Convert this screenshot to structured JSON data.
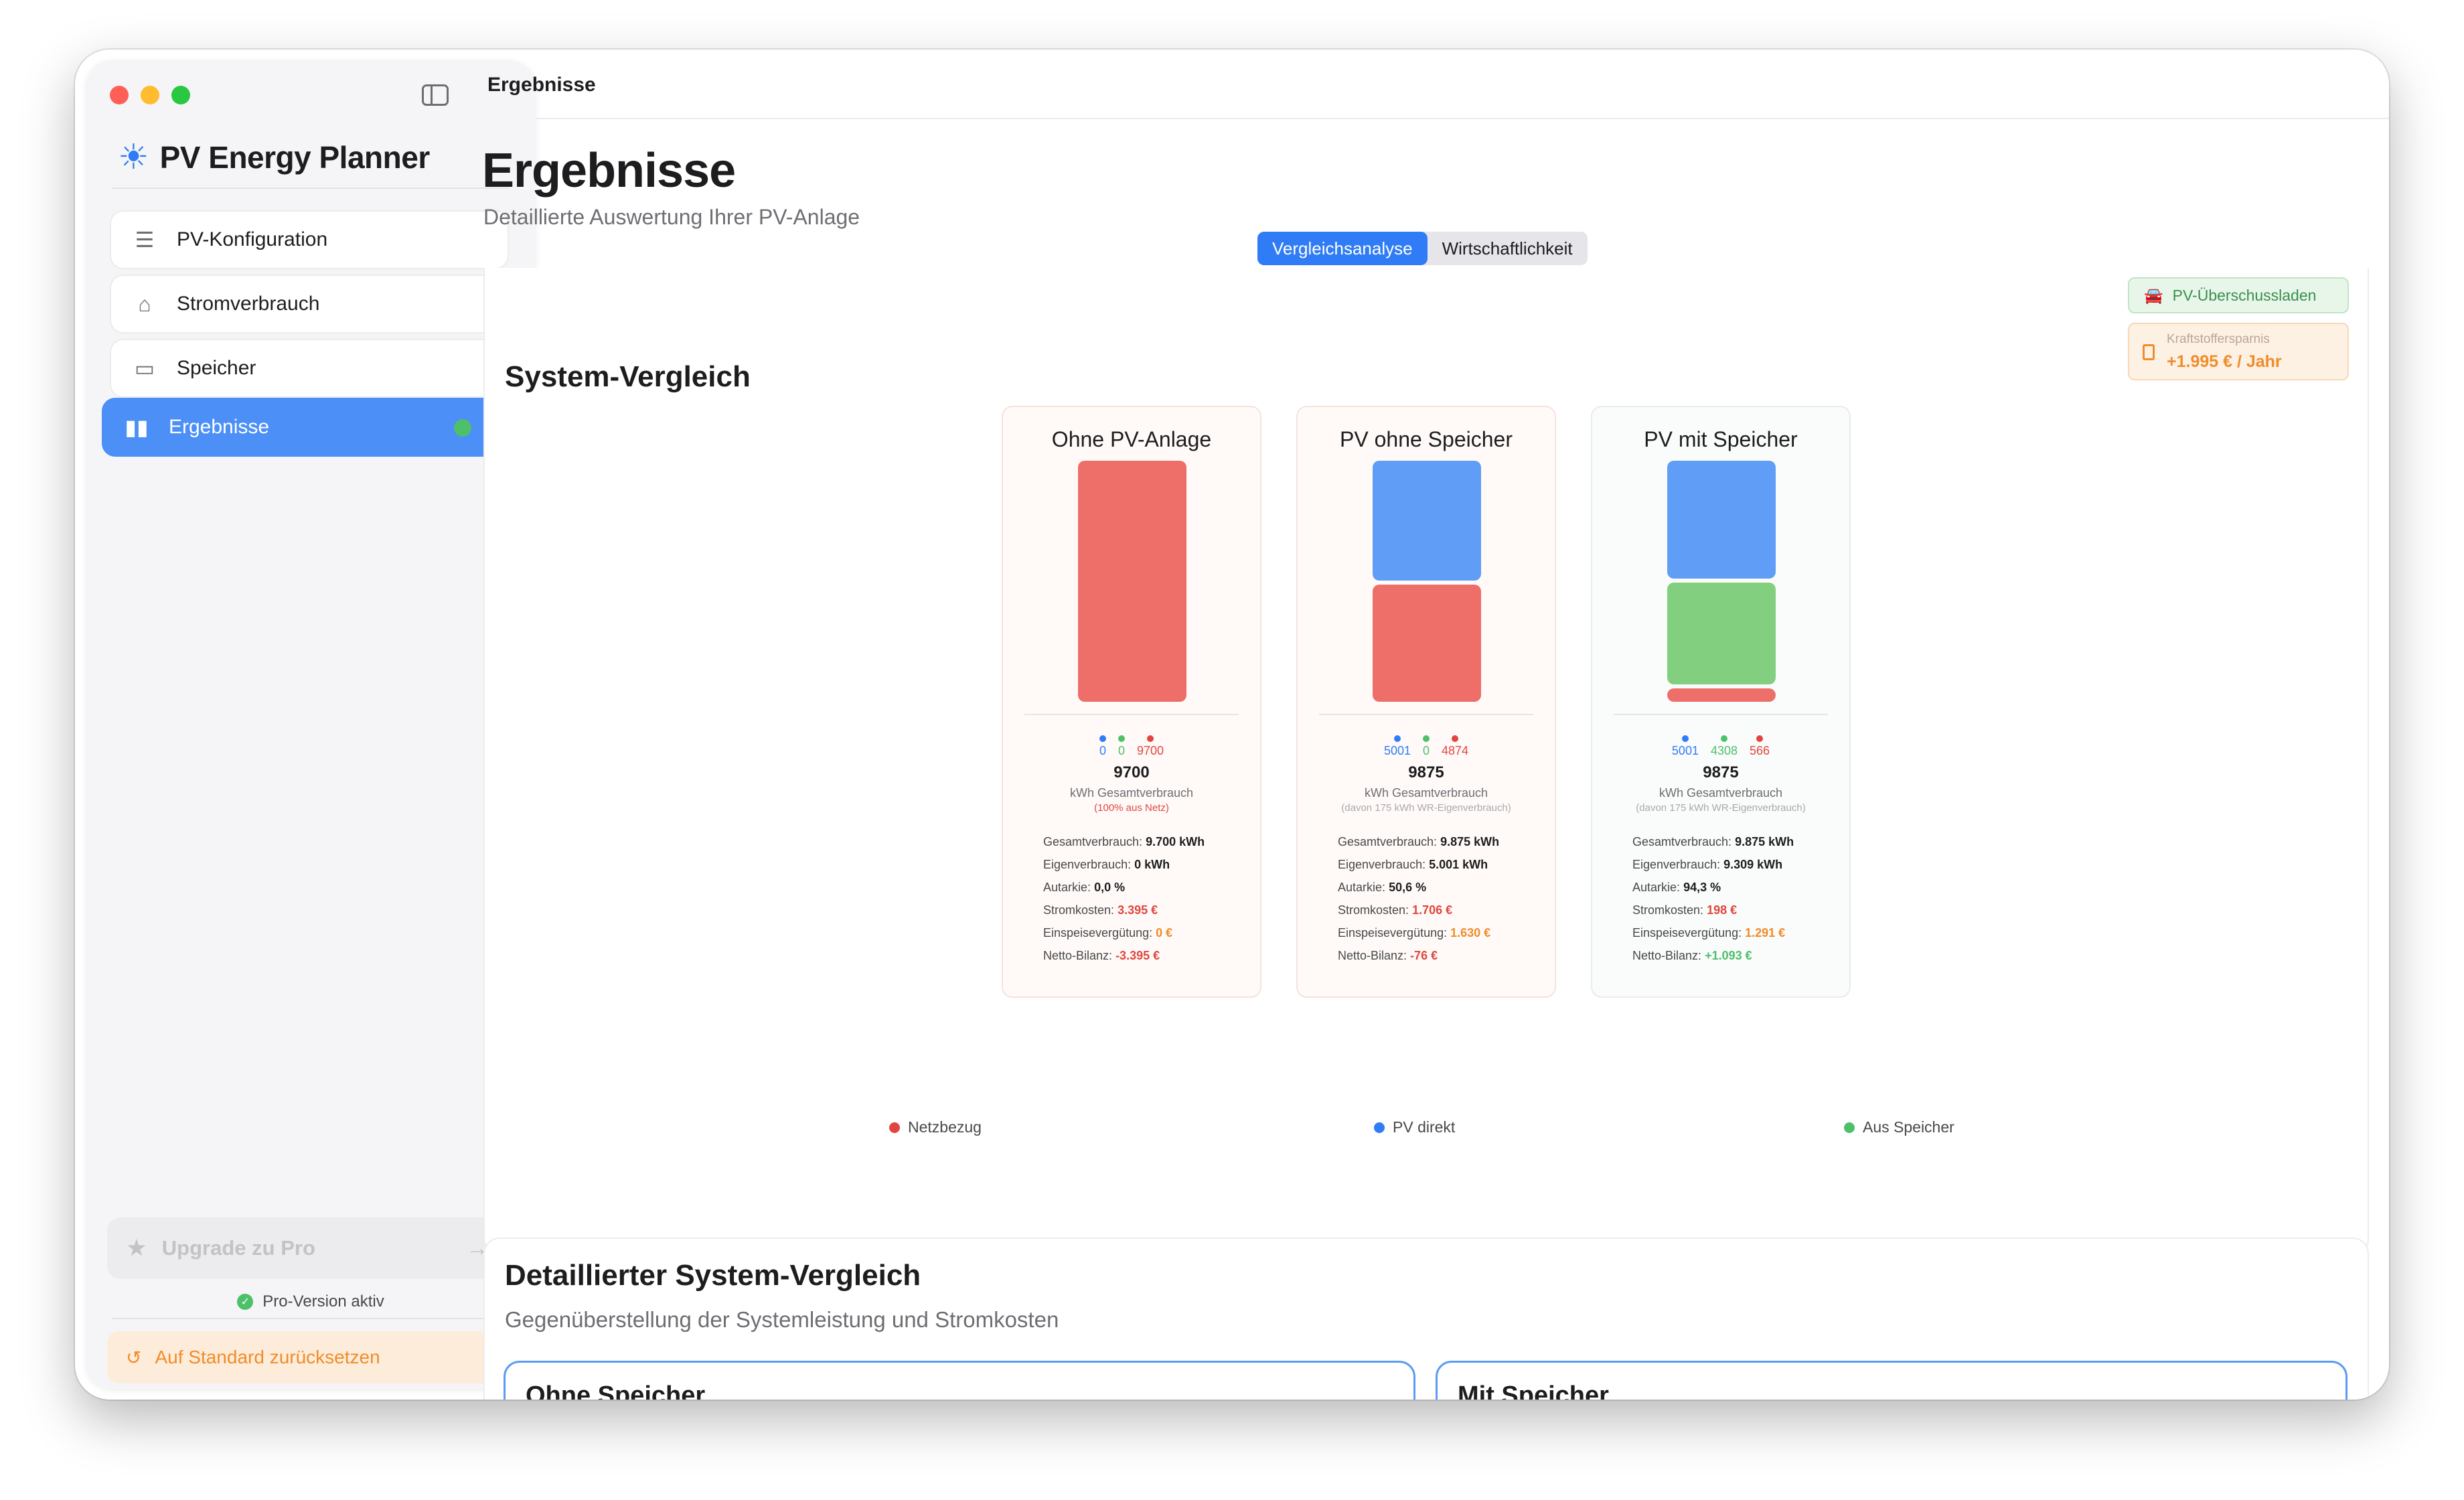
{
  "window": {
    "title": "Ergebnisse"
  },
  "colors": {
    "red": "#ee6e69",
    "blue": "#5f9df6",
    "green": "#83cf80",
    "accent": "#2f7cf6"
  },
  "sidebar": {
    "brand": "PV Energy Planner",
    "items": [
      {
        "label": "PV-Konfiguration",
        "icon": "sliders-icon"
      },
      {
        "label": "Stromverbrauch",
        "icon": "house-icon"
      },
      {
        "label": "Speicher",
        "icon": "battery-icon"
      },
      {
        "label": "Ergebnisse",
        "icon": "chart-bars-icon",
        "active": true
      }
    ],
    "upgrade_label": "Upgrade zu Pro",
    "pro_status": "Pro-Version aktiv",
    "reset_label": "Auf Standard zurücksetzen"
  },
  "main": {
    "title": "Ergebnisse",
    "subtitle": "Detaillierte Auswertung Ihrer PV-Anlage",
    "tabs": [
      {
        "label": "Vergleichsanalyse",
        "active": true
      },
      {
        "label": "Wirtschaftlichkeit",
        "active": false
      }
    ],
    "system_compare": {
      "title": "System-Vergleich",
      "badge_surplus": "PV-Überschussladen",
      "badge_fuel_label": "Kraftstoffersparnis",
      "badge_fuel_value": "+1.995 € / Jahr",
      "columns": [
        {
          "title": "Ohne PV-Anlage",
          "pv_direct": 0,
          "from_storage": 0,
          "grid": 9700,
          "pv_direct_label": "0",
          "from_storage_label": "0",
          "grid_label": "9700",
          "total": "9700",
          "total_unit": "kWh Gesamtverbrauch",
          "note": "(100% aus Netz)",
          "stats": {
            "gesamtverbrauch_label": "Gesamtverbrauch:",
            "gesamtverbrauch": "9.700 kWh",
            "eigenverbrauch_label": "Eigenverbrauch:",
            "eigenverbrauch": "0 kWh",
            "autarkie_label": "Autarkie:",
            "autarkie": "0,0 %",
            "stromkosten_label": "Stromkosten:",
            "stromkosten": "3.395 €",
            "einspeise_label": "Einspeisevergütung:",
            "einspeise": "0 €",
            "netto_label": "Netto-Bilanz:",
            "netto": "-3.395 €"
          }
        },
        {
          "title": "PV ohne Speicher",
          "pv_direct": 5001,
          "from_storage": 0,
          "grid": 4874,
          "pv_direct_label": "5001",
          "from_storage_label": "0",
          "grid_label": "4874",
          "total": "9875",
          "total_unit": "kWh Gesamtverbrauch",
          "note": "(davon 175 kWh WR-Eigenverbrauch)",
          "stats": {
            "gesamtverbrauch_label": "Gesamtverbrauch:",
            "gesamtverbrauch": "9.875 kWh",
            "eigenverbrauch_label": "Eigenverbrauch:",
            "eigenverbrauch": "5.001 kWh",
            "autarkie_label": "Autarkie:",
            "autarkie": "50,6 %",
            "stromkosten_label": "Stromkosten:",
            "stromkosten": "1.706 €",
            "einspeise_label": "Einspeisevergütung:",
            "einspeise": "1.630 €",
            "netto_label": "Netto-Bilanz:",
            "netto": "-76 €"
          }
        },
        {
          "title": "PV mit Speicher",
          "pv_direct": 5001,
          "from_storage": 4308,
          "grid": 566,
          "pv_direct_label": "5001",
          "from_storage_label": "4308",
          "grid_label": "566",
          "total": "9875",
          "total_unit": "kWh Gesamtverbrauch",
          "note": "(davon 175 kWh WR-Eigenverbrauch)",
          "stats": {
            "gesamtverbrauch_label": "Gesamtverbrauch:",
            "gesamtverbrauch": "9.875 kWh",
            "eigenverbrauch_label": "Eigenverbrauch:",
            "eigenverbrauch": "9.309 kWh",
            "autarkie_label": "Autarkie:",
            "autarkie": "94,3 %",
            "stromkosten_label": "Stromkosten:",
            "stromkosten": "198 €",
            "einspeise_label": "Einspeisevergütung:",
            "einspeise": "1.291 €",
            "netto_label": "Netto-Bilanz:",
            "netto": "+1.093 €"
          }
        }
      ],
      "legend": {
        "grid": "Netzbezug",
        "pv_direct": "PV direkt",
        "storage": "Aus Speicher"
      }
    },
    "detail_compare": {
      "title": "Detaillierter System-Vergleich",
      "subtitle": "Gegenüberstellung der Systemleistung und Stromkosten",
      "left_title": "Ohne Speicher",
      "right_title": "Mit Speicher"
    }
  }
}
